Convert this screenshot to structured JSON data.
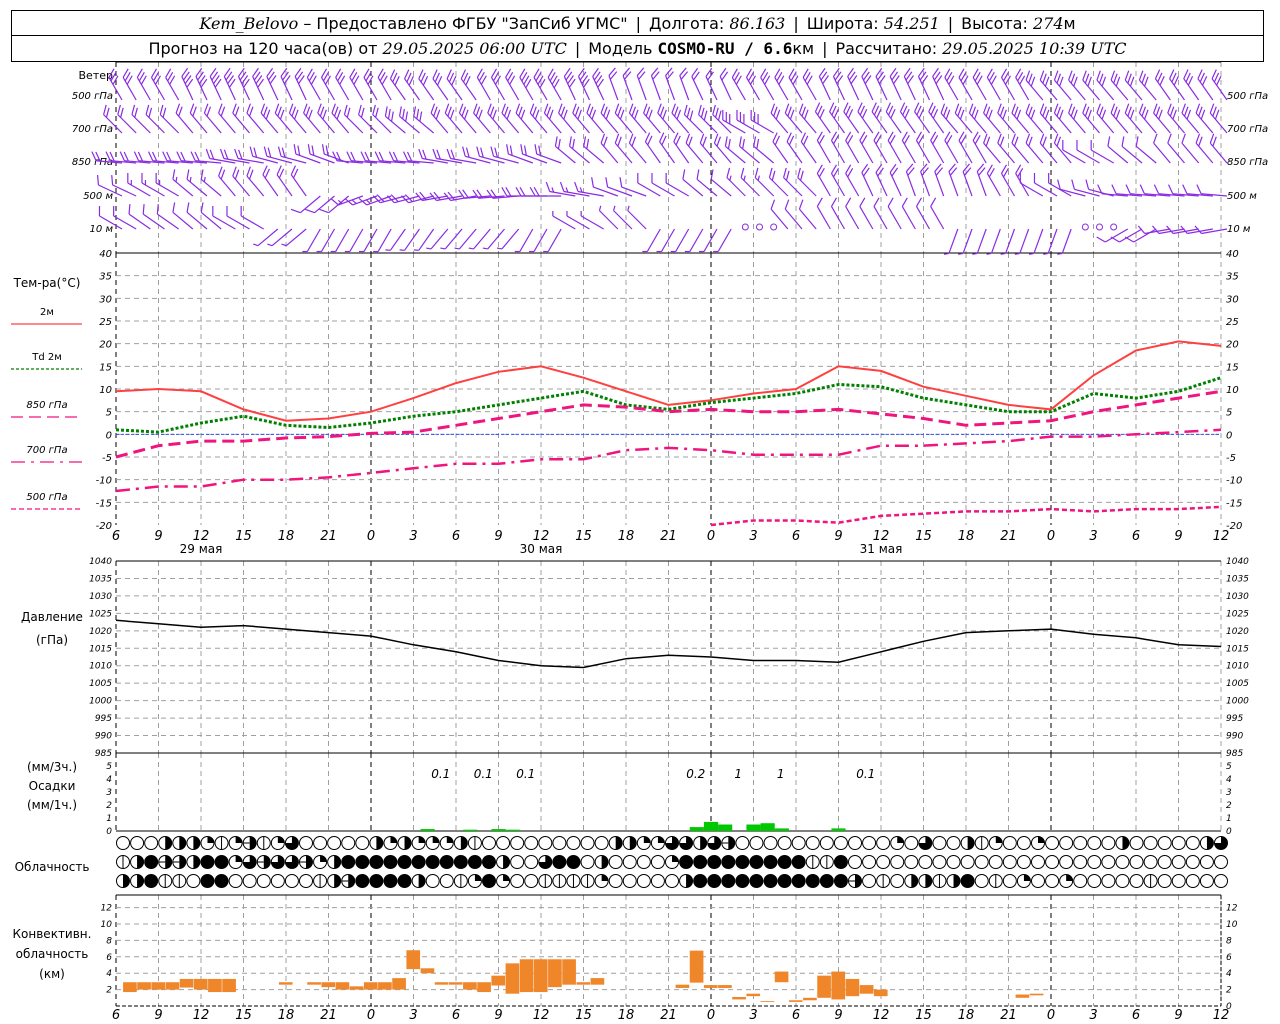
{
  "header": {
    "station": "Kem_Belovo",
    "provider": " – Предоставлено ФГБУ \"ЗапСиб УГМС\"",
    "lon_label": "Долгота: ",
    "lon": "86.163",
    "lat_label": "Широта: ",
    "lat": "54.251",
    "alt_label": "Высота: ",
    "alt": "274",
    "alt_unit": "м",
    "forecast_label": "Прогноз на 120 часа(ов) от ",
    "forecast_time": "29.05.2025 06:00 UTC",
    "model_label": "Модель ",
    "model": "COSMO-RU / 6.6",
    "model_unit": "км",
    "calc_label": "Рассчитано: ",
    "calc_time": "29.05.2025 10:39 UTC"
  },
  "labels": {
    "wind": "Ветер",
    "wind_levels": [
      "500 гПа",
      "700 гПа",
      "850 гПа",
      "500 м",
      "10  м"
    ],
    "temp_title": "Тем-ра(°C)",
    "temp_legend": [
      "2м",
      "Td  2м",
      "850 гПа",
      "700 гПа",
      "500 гПа"
    ],
    "pressure": [
      "Давление",
      "(гПа)"
    ],
    "precip": [
      "(мм/3ч.)",
      "Осадки",
      "(мм/1ч.)"
    ],
    "cloud": "Облачность",
    "conv": [
      "Конвективн.",
      "облачность",
      "(км)"
    ]
  },
  "colors": {
    "t2m": "#ff4040",
    "td2m": "#008000",
    "upper": "#f0147e",
    "zero_line": "#3050ff",
    "wind": "#8a2be2",
    "precip": "#00c800",
    "conv": "#f0862a",
    "grid": "#a0a0a0"
  },
  "chart_data": [
    {
      "type": "wind_barbs",
      "title": "Ветер",
      "hours_from_start": [
        0,
        3,
        6,
        9,
        12,
        15,
        18,
        21,
        24,
        27,
        30,
        33,
        36,
        39,
        42,
        45,
        48,
        51,
        54,
        57,
        60,
        63,
        66,
        69,
        72,
        75,
        78
      ],
      "x_tick_labels": [
        "6",
        "9",
        "12",
        "15",
        "18",
        "21",
        "0",
        "3",
        "6",
        "9",
        "12",
        "15",
        "18",
        "21",
        "0",
        "3",
        "6",
        "9",
        "12",
        "15",
        "18",
        "21",
        "0",
        "3",
        "6",
        "9",
        "12"
      ],
      "levels": [
        {
          "name": "500 гПа",
          "dir": [
            330,
            330,
            335,
            335,
            335,
            330,
            330,
            325,
            325,
            330,
            330,
            335,
            340,
            340,
            335,
            330,
            330,
            335,
            335,
            335,
            330,
            330,
            320,
            320,
            320,
            325,
            325
          ],
          "speed": [
            15,
            17,
            20,
            20,
            17,
            17,
            15,
            17,
            17,
            17,
            20,
            22,
            12,
            10,
            10,
            17,
            15,
            17,
            17,
            15,
            15,
            17,
            15,
            15,
            15,
            15,
            15
          ]
        },
        {
          "name": "700 гПа",
          "dir": [
            315,
            315,
            320,
            320,
            320,
            320,
            315,
            310,
            320,
            320,
            320,
            320,
            320,
            320,
            315,
            300,
            320,
            325,
            325,
            325,
            320,
            320,
            320,
            320,
            320,
            320,
            320
          ],
          "speed": [
            12,
            12,
            12,
            12,
            15,
            15,
            12,
            15,
            15,
            15,
            15,
            15,
            17,
            15,
            15,
            15,
            17,
            17,
            15,
            15,
            17,
            17,
            17,
            15,
            15,
            15,
            15
          ]
        },
        {
          "name": "850 гПа",
          "dir": [
            275,
            275,
            275,
            280,
            285,
            290,
            275,
            275,
            280,
            285,
            290,
            310,
            320,
            325,
            320,
            310,
            325,
            330,
            330,
            330,
            330,
            320,
            320,
            300,
            310,
            320,
            320
          ],
          "speed": [
            10,
            10,
            10,
            12,
            12,
            12,
            10,
            10,
            10,
            12,
            12,
            12,
            12,
            12,
            12,
            12,
            12,
            12,
            12,
            12,
            12,
            12,
            10,
            7,
            5,
            7,
            10
          ]
        },
        {
          "name": "500 м",
          "dir": [
            295,
            300,
            310,
            320,
            325,
            230,
            250,
            255,
            260,
            265,
            270,
            280,
            290,
            300,
            310,
            315,
            315,
            330,
            335,
            340,
            340,
            330,
            300,
            285,
            275,
            275,
            275
          ],
          "speed": [
            7,
            8,
            8,
            10,
            10,
            5,
            8,
            10,
            10,
            10,
            10,
            8,
            7,
            7,
            7,
            8,
            10,
            10,
            10,
            10,
            10,
            10,
            5,
            5,
            5,
            5,
            5
          ]
        },
        {
          "name": "10 м",
          "dir": [
            300,
            305,
            310,
            300,
            230,
            210,
            210,
            215,
            220,
            220,
            210,
            300,
            315,
            210,
            210,
            0,
            320,
            330,
            330,
            330,
            200,
            200,
            200,
            0,
            240,
            260,
            260
          ],
          "speed": [
            5,
            5,
            5,
            5,
            4,
            4,
            4,
            4,
            4,
            4,
            4,
            4,
            3,
            3,
            3,
            0,
            5,
            5,
            5,
            5,
            3,
            3,
            3,
            0,
            5,
            5,
            5
          ]
        }
      ]
    },
    {
      "type": "line",
      "title": "Тем-ра(°C)",
      "ylim": [
        -20,
        40
      ],
      "y_ticks": [
        -20,
        -15,
        -10,
        -5,
        0,
        5,
        10,
        15,
        20,
        25,
        30,
        35,
        40
      ],
      "grid": true,
      "x_tick_labels": [
        "6",
        "9",
        "12",
        "15",
        "18",
        "21",
        "0",
        "3",
        "6",
        "9",
        "12",
        "15",
        "18",
        "21",
        "0",
        "3",
        "6",
        "9",
        "12",
        "15",
        "18",
        "21",
        "0",
        "3",
        "6",
        "9",
        "12"
      ],
      "date_labels": [
        {
          "label": "29 мая",
          "hour": 6
        },
        {
          "label": "30 мая",
          "hour": 30
        },
        {
          "label": "31 мая",
          "hour": 54
        }
      ],
      "hours_from_start": [
        0,
        3,
        6,
        9,
        12,
        15,
        18,
        21,
        24,
        27,
        30,
        33,
        36,
        39,
        42,
        45,
        48,
        51,
        54,
        57,
        60,
        63,
        66,
        69,
        72,
        75,
        78
      ],
      "series": [
        {
          "name": "2м",
          "style": "solid",
          "values": [
            9.5,
            10,
            9.5,
            5.5,
            3,
            3.5,
            5,
            8,
            11.3,
            13.8,
            15,
            12.5,
            9.5,
            6.5,
            7.5,
            9,
            10,
            15,
            14,
            10.5,
            8.5,
            6.5,
            5.5,
            13,
            18.5,
            20.5,
            19.5
          ]
        },
        {
          "name": "Td  2м",
          "style": "dotted",
          "values": [
            1,
            0.5,
            2.5,
            4,
            2,
            1.5,
            2.5,
            4,
            5,
            6.5,
            8,
            9.5,
            6.5,
            5.5,
            7,
            8,
            9,
            11,
            10.5,
            8,
            6.5,
            5,
            5,
            9,
            8,
            9.5,
            12.5
          ]
        },
        {
          "name": "850 гПа",
          "style": "dashed",
          "values": [
            -5,
            -2.5,
            -1.5,
            -1.5,
            -0.8,
            -0.5,
            0.2,
            0.5,
            2,
            3.5,
            5,
            6.5,
            6,
            5,
            5.5,
            5,
            5,
            5.5,
            4.5,
            3.5,
            2,
            2.5,
            3,
            5,
            6.5,
            8,
            9.5
          ]
        },
        {
          "name": "700 гПа",
          "style": "dashdot",
          "values": [
            -12.5,
            -11.5,
            -11.5,
            -10,
            -10,
            -9.5,
            -8.5,
            -7.5,
            -6.5,
            -6.5,
            -5.5,
            -5.5,
            -3.5,
            -3,
            -3.5,
            -4.5,
            -4.5,
            -4.5,
            -2.5,
            -2.5,
            -2,
            -1.5,
            -0.5,
            -0.5,
            0,
            0.5,
            1
          ]
        },
        {
          "name": "500 гПа",
          "style": "shortdash",
          "values": [
            null,
            null,
            null,
            null,
            null,
            null,
            null,
            null,
            null,
            null,
            null,
            null,
            null,
            null,
            -20,
            -19,
            -19,
            -19.5,
            -18,
            -17.5,
            -17,
            -17,
            -16.5,
            -17,
            -16.5,
            -16.5,
            -16
          ]
        }
      ]
    },
    {
      "type": "line",
      "title": "Давление (гПа)",
      "ylim": [
        985,
        1040
      ],
      "y_ticks": [
        985,
        990,
        995,
        1000,
        1005,
        1010,
        1015,
        1020,
        1025,
        1030,
        1035,
        1040
      ],
      "grid": true,
      "hours_from_start": [
        0,
        3,
        6,
        9,
        12,
        15,
        18,
        21,
        24,
        27,
        30,
        33,
        36,
        39,
        42,
        45,
        48,
        51,
        54,
        57,
        60,
        63,
        66,
        69,
        72,
        75,
        78
      ],
      "values": [
        1023,
        1022,
        1021,
        1021.5,
        1020.5,
        1019.5,
        1018.5,
        1016,
        1014,
        1011.5,
        1010,
        1009.5,
        1012,
        1013,
        1012.5,
        1011.5,
        1011.5,
        1011,
        1014,
        1017,
        1019.5,
        1020,
        1020.5,
        1019,
        1018,
        1016,
        1015.5
      ]
    },
    {
      "type": "bar",
      "title": "Осадки",
      "ylim": [
        0,
        5
      ],
      "y_ticks": [
        0,
        1,
        2,
        3,
        4,
        5
      ],
      "hourly": [
        {
          "hour": 22,
          "mm": 0.15
        },
        {
          "hour": 25,
          "mm": 0.1
        },
        {
          "hour": 27,
          "mm": 0.15
        },
        {
          "hour": 28,
          "mm": 0.1
        },
        {
          "hour": 41,
          "mm": 0.3
        },
        {
          "hour": 42,
          "mm": 0.7
        },
        {
          "hour": 43,
          "mm": 0.5
        },
        {
          "hour": 45,
          "mm": 0.5
        },
        {
          "hour": 46,
          "mm": 0.6
        },
        {
          "hour": 47,
          "mm": 0.2
        },
        {
          "hour": 51,
          "mm": 0.2
        }
      ],
      "three_hour_totals": [
        {
          "hour": 22.5,
          "label": "0.1"
        },
        {
          "hour": 25.5,
          "label": "0.1"
        },
        {
          "hour": 28.5,
          "label": "0.1"
        },
        {
          "hour": 40.5,
          "label": "0.2"
        },
        {
          "hour": 43.5,
          "label": "1"
        },
        {
          "hour": 46.5,
          "label": "1"
        },
        {
          "hour": 52.5,
          "label": "0.1"
        }
      ]
    },
    {
      "type": "cloud_symbols",
      "title": "Облачность",
      "legend": "0 clear, 1 trace line, 2 quarter, 4 half, 5 half with line, 6 three-quarter, 8 overcast",
      "rows": [
        "0004442125126000004242224100000000044226646500000000000206004120020000040000046",
        "1485548826566524888888888884006880400002888888888118000000000000000000000000000",
        "4481108800000014588884001282001111200000488888888888501044148010200200000100000"
      ]
    },
    {
      "type": "bar_range",
      "title": "Конвективн. облачность (км)",
      "ylim": [
        0,
        13
      ],
      "y_ticks": [
        0,
        2,
        4,
        6,
        8,
        10,
        12
      ],
      "bars": [
        {
          "hour": 1,
          "base": 1.7,
          "top": 2.9
        },
        {
          "hour": 2,
          "base": 2.0,
          "top": 2.9
        },
        {
          "hour": 3,
          "base": 2.0,
          "top": 2.9
        },
        {
          "hour": 4,
          "base": 2.0,
          "top": 2.9
        },
        {
          "hour": 5,
          "base": 2.25,
          "top": 3.3
        },
        {
          "hour": 6,
          "base": 2.0,
          "top": 3.3
        },
        {
          "hour": 7,
          "base": 1.7,
          "top": 3.3
        },
        {
          "hour": 8,
          "base": 1.7,
          "top": 3.3
        },
        {
          "hour": 12,
          "base": 2.6,
          "top": 2.9
        },
        {
          "hour": 14,
          "base": 2.6,
          "top": 2.9
        },
        {
          "hour": 15,
          "base": 2.3,
          "top": 2.9
        },
        {
          "hour": 16,
          "base": 2.0,
          "top": 2.9
        },
        {
          "hour": 17,
          "base": 2.0,
          "top": 2.4
        },
        {
          "hour": 18,
          "base": 2.0,
          "top": 2.9
        },
        {
          "hour": 19,
          "base": 2.0,
          "top": 2.9
        },
        {
          "hour": 20,
          "base": 2.0,
          "top": 3.4
        },
        {
          "hour": 21,
          "base": 4.5,
          "top": 6.8
        },
        {
          "hour": 22,
          "base": 4.0,
          "top": 4.6
        },
        {
          "hour": 23,
          "base": 2.6,
          "top": 2.9
        },
        {
          "hour": 24,
          "base": 2.6,
          "top": 2.9
        },
        {
          "hour": 25,
          "base": 2.0,
          "top": 2.9
        },
        {
          "hour": 26,
          "base": 1.7,
          "top": 2.9
        },
        {
          "hour": 27,
          "base": 2.5,
          "top": 3.7
        },
        {
          "hour": 28,
          "base": 1.5,
          "top": 5.2
        },
        {
          "hour": 29,
          "base": 1.7,
          "top": 5.7
        },
        {
          "hour": 30,
          "base": 1.7,
          "top": 5.7
        },
        {
          "hour": 31,
          "base": 2.3,
          "top": 5.7
        },
        {
          "hour": 32,
          "base": 2.6,
          "top": 5.7
        },
        {
          "hour": 33,
          "base": 2.6,
          "top": 2.9
        },
        {
          "hour": 34,
          "base": 2.6,
          "top": 3.4
        },
        {
          "hour": 40,
          "base": 2.2,
          "top": 2.6
        },
        {
          "hour": 41,
          "base": 2.85,
          "top": 6.75
        },
        {
          "hour": 42,
          "base": 2.2,
          "top": 2.55
        },
        {
          "hour": 43,
          "base": 2.2,
          "top": 2.55
        },
        {
          "hour": 44,
          "base": 0.8,
          "top": 1.1
        },
        {
          "hour": 45,
          "base": 1.2,
          "top": 1.5
        },
        {
          "hour": 46,
          "base": 0.5,
          "top": 0.6
        },
        {
          "hour": 47,
          "base": 2.9,
          "top": 4.2
        },
        {
          "hour": 48,
          "base": 0.5,
          "top": 0.7
        },
        {
          "hour": 49,
          "base": 0.7,
          "top": 1.0
        },
        {
          "hour": 50,
          "base": 1.0,
          "top": 3.7
        },
        {
          "hour": 51,
          "base": 0.8,
          "top": 4.2
        },
        {
          "hour": 52,
          "base": 1.2,
          "top": 3.3
        },
        {
          "hour": 53,
          "base": 1.5,
          "top": 2.55
        },
        {
          "hour": 54,
          "base": 1.2,
          "top": 2.0
        },
        {
          "hour": 64,
          "base": 1.0,
          "top": 1.4
        },
        {
          "hour": 65,
          "base": 1.3,
          "top": 1.5
        }
      ]
    }
  ]
}
